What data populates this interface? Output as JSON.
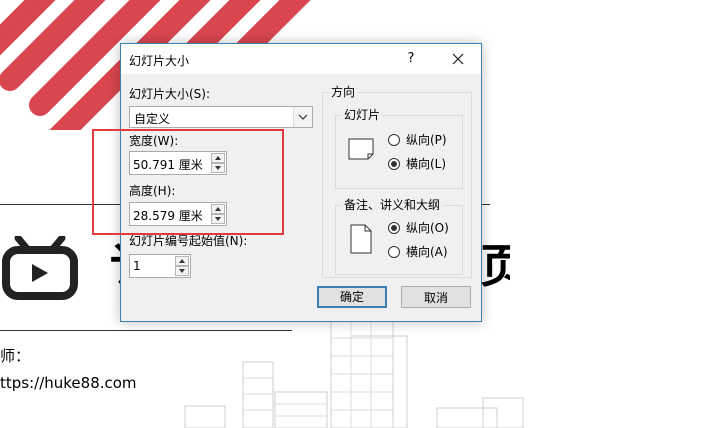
{
  "dialog": {
    "title": "幻灯片大小",
    "help_label": "?",
    "size_label": "幻灯片大小(S):",
    "size_value": "自定义",
    "width_label": "宽度(W):",
    "width_value": "50.791 厘米",
    "height_label": "高度(H):",
    "height_value": "28.579 厘米",
    "number_label": "幻灯片编号起始值(N):",
    "number_value": "1",
    "orientation_label": "方向",
    "slides_group": "幻灯片",
    "slides_portrait": "纵向(P)",
    "slides_landscape": "横向(L)",
    "notes_group": "备注、讲义和大纲",
    "notes_portrait": "纵向(O)",
    "notes_landscape": "横向(A)",
    "ok_label": "确定",
    "cancel_label": "取消"
  },
  "background": {
    "teacher_label": "师：",
    "url": "ttps://huke88.com",
    "title_left": "讠",
    "title_right": "页"
  },
  "colors": {
    "stripe": "#d9464f",
    "highlight": "#e03a3a",
    "dialog_border": "#3c7fb1"
  }
}
